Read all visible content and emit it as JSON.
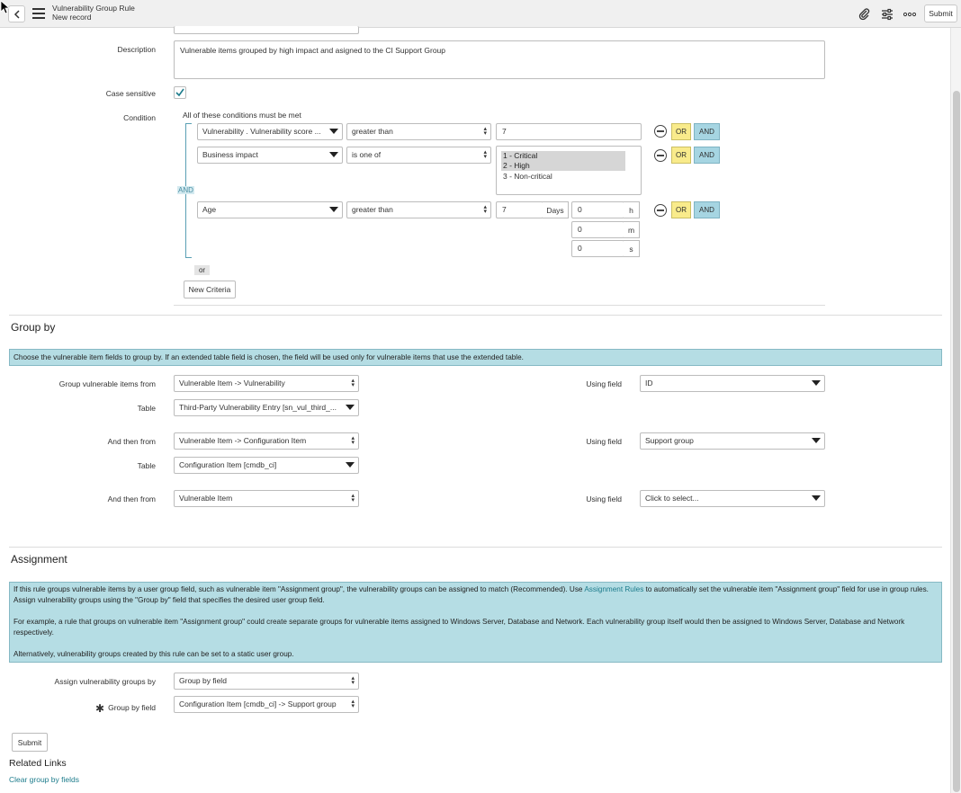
{
  "header": {
    "title": "Vulnerability Group Rule",
    "subtitle": "New record",
    "submit_label": "Submit"
  },
  "form": {
    "description_label": "Description",
    "description_value": "Vulnerable items grouped by high impact and asigned to the CI Support Group",
    "case_sensitive_label": "Case sensitive",
    "case_sensitive_checked": true,
    "condition_label": "Condition",
    "condition_caption": "All of these conditions must be met",
    "and_connector": "AND",
    "conditions": [
      {
        "field": "Vulnerability . Vulnerability score ...",
        "operator": "greater than",
        "value": "7"
      },
      {
        "field": "Business impact",
        "operator": "is one of",
        "options": [
          "1 - Critical",
          "2 - High",
          "3 - Non-critical"
        ],
        "selected": [
          "1 - Critical",
          "2 - High"
        ]
      },
      {
        "field": "Age",
        "operator": "greater than",
        "value": "7",
        "unit": "Days",
        "duration": [
          {
            "value": "0",
            "unit": "h"
          },
          {
            "value": "0",
            "unit": "m"
          },
          {
            "value": "0",
            "unit": "s"
          }
        ]
      }
    ],
    "or_button": "OR",
    "and_button": "AND",
    "or_separator": "or",
    "new_criteria_label": "New Criteria"
  },
  "group_by": {
    "title": "Group by",
    "info": "Choose the vulnerable item fields to group by. If an extended table field is chosen, the field will be used only for vulnerable items that use the extended table.",
    "rows": [
      {
        "from_label": "Group vulnerable items from",
        "from_value": "Vulnerable Item -> Vulnerability",
        "using_label": "Using field",
        "using_value": "ID",
        "table_label": "Table",
        "table_value": "Third-Party Vulnerability Entry [sn_vul_third_..."
      },
      {
        "from_label": "And then from",
        "from_value": "Vulnerable Item -> Configuration Item",
        "using_label": "Using field",
        "using_value": "Support group",
        "table_label": "Table",
        "table_value": "Configuration Item [cmdb_ci]"
      },
      {
        "from_label": "And then from",
        "from_value": "Vulnerable Item",
        "using_label": "Using field",
        "using_value": "Click to select..."
      }
    ]
  },
  "assignment": {
    "title": "Assignment",
    "info_p1_before": "If this rule groups vulnerable items by a user group field, such as vulnerable item \"Assignment group\", the vulnerability groups can be assigned to match (Recommended). Use ",
    "info_p1_link": "Assignment Rules",
    "info_p1_after": " to automatically set the vulnerable item \"Assignment group\" field for use in group rules. Assign vulnerability groups using the \"Group by\" field that specifies the desired user group field.",
    "info_p2": "For example, a rule that groups on vulnerable item \"Assignment group\" could create separate groups for vulnerable items assigned to Windows Server, Database and Network. Each vulnerability group itself would then be assigned to Windows Server, Database and Network respectively.",
    "info_p3": "Alternatively, vulnerability groups created by this rule can be set to a static user group.",
    "assign_by_label": "Assign vulnerability groups by",
    "assign_by_value": "Group by field",
    "group_by_field_label": "Group by field",
    "group_by_field_value": "Configuration Item [cmdb_ci] -> Support group",
    "required_mark": "✱"
  },
  "footer": {
    "submit_label": "Submit",
    "related_links_title": "Related Links",
    "clear_link": "Clear group by fields"
  }
}
